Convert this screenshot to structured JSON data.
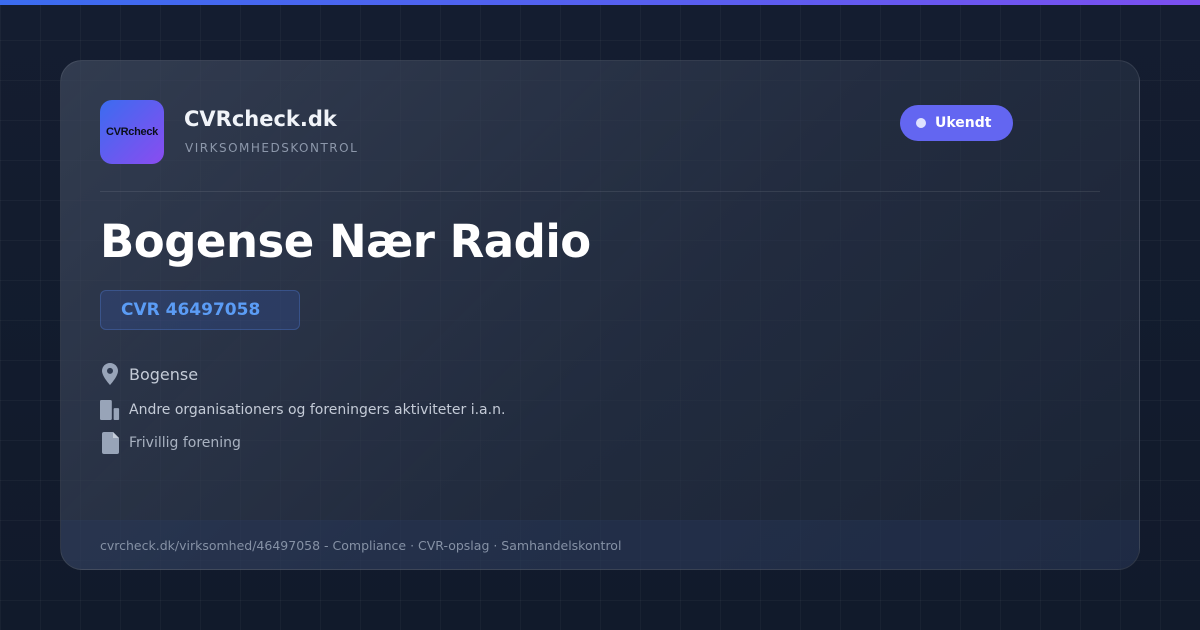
{
  "brand": {
    "name": "CVRcheck.dk",
    "tagline": "VIRKSOMHEDSKONTROL",
    "logo_text": "CVRcheck",
    "logo_icon": "cvrcheck-logo"
  },
  "status": {
    "label": "Ukendt",
    "color": "#6366f1"
  },
  "company": {
    "name": "Bogense Nær Radio",
    "cvr": "CVR 46497058"
  },
  "details": {
    "location": {
      "icon": "map-pin-icon",
      "text": "Bogense"
    },
    "industry": {
      "icon": "building-icon",
      "text": "Andre organisationers og foreningers aktiviteter i.a.n."
    },
    "legal_form": {
      "icon": "document-icon",
      "text": "Frivillig forening"
    }
  },
  "footer": {
    "text": "cvrcheck.dk/virksomhed/46497058 - Compliance · CVR-opslag · Samhandelskontrol"
  },
  "colors": {
    "accent_start": "#3b6cf0",
    "accent_end": "#7c4ff0",
    "cvr_text": "#5b9cf5",
    "background": "#131c2e"
  }
}
